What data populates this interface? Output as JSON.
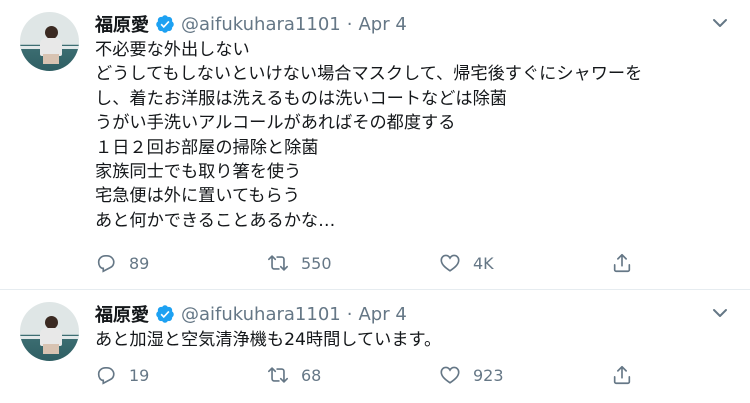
{
  "tweets": [
    {
      "name": "福原愛",
      "handle": "@aifukuhara1101",
      "date": "Apr 4",
      "text": "不必要な外出しない\nどうしてもしないといけない場合マスクして、帰宅後すぐにシャワーを\nし、着たお洋服は洗えるものは洗いコートなどは除菌\nうがい手洗いアルコールがあればその都度する\n１日２回お部屋の掃除と除菌\n家族同士でも取り箸を使う\n宅急便は外に置いてもらう\nあと何かできることあるかな…",
      "replies": "89",
      "retweets": "550",
      "likes": "4K"
    },
    {
      "name": "福原愛",
      "handle": "@aifukuhara1101",
      "date": "Apr 4",
      "text": "あと加湿と空気清浄機も24時間しています。",
      "replies": "19",
      "retweets": "68",
      "likes": "923"
    }
  ],
  "icons": {
    "verified": "verified-badge-icon",
    "menu": "chevron-down-icon",
    "reply": "reply-icon",
    "retweet": "retweet-icon",
    "like": "heart-icon",
    "share": "share-icon"
  },
  "colors": {
    "verified": "#1da1f2",
    "secondary_text": "#657786",
    "divider": "#e6ecf0"
  }
}
